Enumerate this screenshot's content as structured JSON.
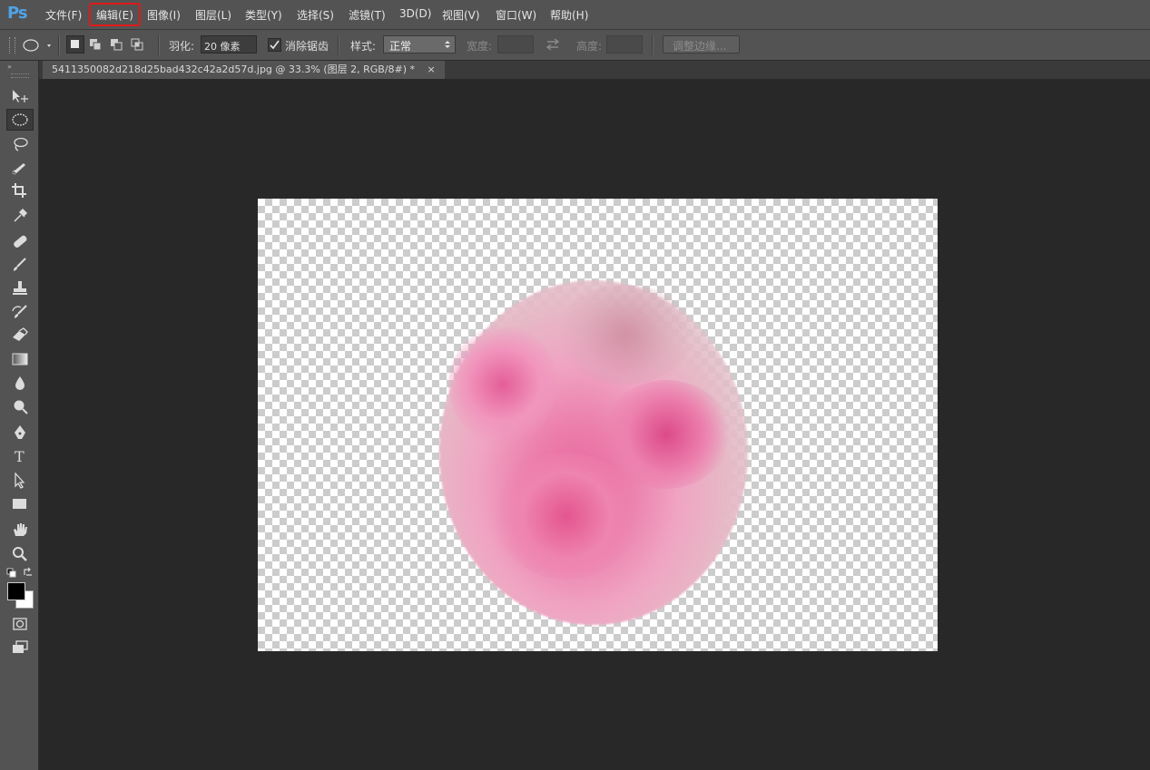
{
  "app": {
    "logo": "Ps"
  },
  "menu": [
    {
      "label": "文件(F)"
    },
    {
      "label": "编辑(E)",
      "highlighted": true
    },
    {
      "label": "图像(I)"
    },
    {
      "label": "图层(L)"
    },
    {
      "label": "类型(Y)"
    },
    {
      "label": "选择(S)"
    },
    {
      "label": "滤镜(T)"
    },
    {
      "label": "3D(D)"
    },
    {
      "label": "视图(V)"
    },
    {
      "label": "窗口(W)"
    },
    {
      "label": "帮助(H)"
    }
  ],
  "options": {
    "feather_label": "羽化:",
    "feather_value": "20 像素",
    "antialias_label": "消除锯齿",
    "antialias_checked": true,
    "style_label": "样式:",
    "style_value": "正常",
    "width_label": "宽度:",
    "height_label": "高度:",
    "refine_label": "调整边缘..."
  },
  "document": {
    "tab_title": "5411350082d218d25bad432c42a2d57d.jpg @ 33.3% (图层 2, RGB/8#) *",
    "close_glyph": "×"
  },
  "tools": [
    "move-tool",
    "elliptical-marquee-tool",
    "lasso-tool",
    "quick-selection-tool",
    "crop-tool",
    "eyedropper-tool",
    "healing-brush-tool",
    "brush-tool",
    "clone-stamp-tool",
    "history-brush-tool",
    "eraser-tool",
    "gradient-tool",
    "blur-tool",
    "dodge-tool",
    "pen-tool",
    "type-tool",
    "path-selection-tool",
    "rectangle-tool",
    "hand-tool",
    "zoom-tool"
  ],
  "colors": {
    "foreground": "#000000",
    "background": "#ffffff",
    "highlight": "#e01a1a"
  }
}
